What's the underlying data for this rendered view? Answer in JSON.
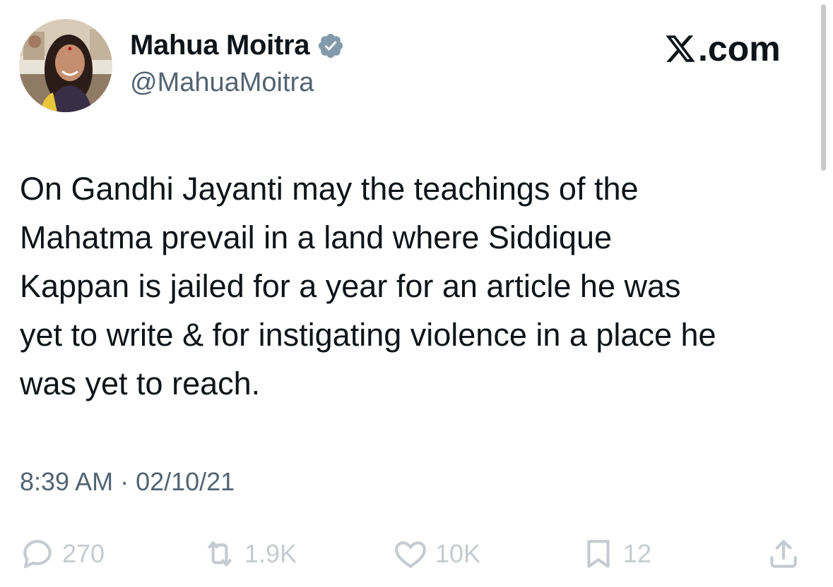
{
  "author": {
    "display_name": "Mahua Moitra",
    "handle": "@MahuaMoitra",
    "verified": true,
    "avatar_icon": "profile-photo"
  },
  "site": {
    "logo_text": ".com",
    "logo_icon": "x-logo-icon"
  },
  "tweet": {
    "text": "On Gandhi Jayanti may the teachings of the\nMahatma prevail in a land where Siddique\nKappan is jailed for a year for an article he was\nyet to write & for instigating violence in a place he\nwas yet to reach.",
    "time": "8:39 AM · 02/10/21"
  },
  "actions": {
    "replies": "270",
    "reposts": "1.9K",
    "likes": "10K",
    "bookmarks": "12"
  },
  "colors": {
    "text": "#0f1419",
    "secondary": "#536471",
    "verified_badge": "#829aab",
    "action_icons": "#c5cbd0"
  }
}
